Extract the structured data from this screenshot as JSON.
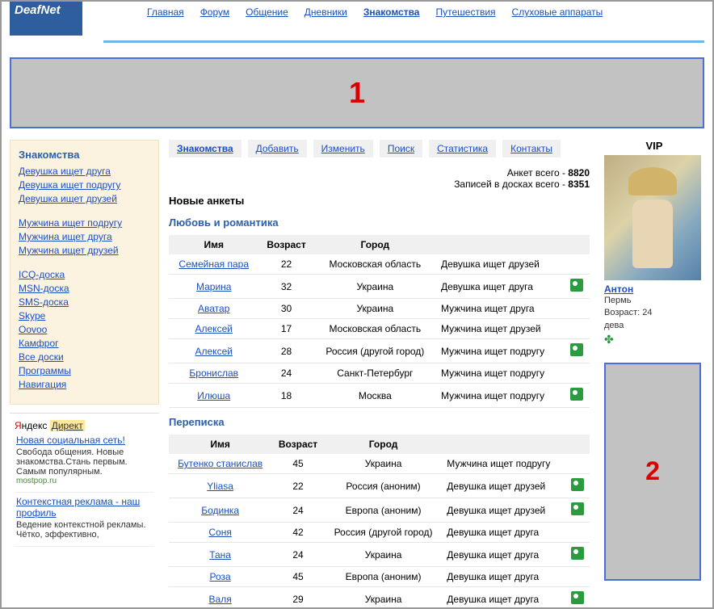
{
  "logo": "DeafNet",
  "nav": [
    "Главная",
    "Форум",
    "Общение",
    "Дневники",
    "Знакомства",
    "Путешествия",
    "Слуховые аппараты"
  ],
  "nav_active": 4,
  "banner1_num": "1",
  "banner2_num": "2",
  "left_title": "Знакомства",
  "left_group1": [
    "Девушка ищет друга",
    "Девушка ищет подругу",
    "Девушка ищет друзей"
  ],
  "left_group2": [
    "Мужчина ищет подругу",
    "Мужчина ищет друга",
    "Мужчина ищет друзей"
  ],
  "left_group3": [
    "ICQ-доска",
    "MSN-доска",
    "SMS-доска",
    "Skype",
    "Oovoo",
    "Камфрог",
    "Все доски",
    "Программы",
    "Навигация"
  ],
  "yandex": {
    "y": "Я",
    "ndex": "ндекс",
    "direct": "Директ"
  },
  "ads": [
    {
      "title": "Новая социальная сеть!",
      "desc": "Свобода общения. Новые знакомства.Стань первым. Самым популярным.",
      "src": "mostpop.ru"
    },
    {
      "title": "Контекстная реклама - наш профиль",
      "desc": "Ведение контекстной рекламы. Чётко, эффективно,",
      "src": ""
    }
  ],
  "subnav": [
    "Знакомства",
    "Добавить",
    "Изменить",
    "Поиск",
    "Статистика",
    "Контакты"
  ],
  "stats": {
    "l1a": "Анкет всего - ",
    "l1b": "8820",
    "l2a": "Записей в досках всего - ",
    "l2b": "8351"
  },
  "new_title": "Новые анкеты",
  "headers": {
    "name": "Имя",
    "age": "Возраст",
    "city": "Город"
  },
  "cat1": {
    "title": "Любовь и романтика",
    "rows": [
      {
        "name": "Семейная пара",
        "age": "22",
        "city": "Московская область",
        "type": "Девушка ищет друзей",
        "photo": false
      },
      {
        "name": "Марина",
        "age": "32",
        "city": "Украина",
        "type": "Девушка ищет друга",
        "photo": true
      },
      {
        "name": "Аватар",
        "age": "30",
        "city": "Украина",
        "type": "Мужчина ищет друга",
        "photo": false
      },
      {
        "name": "Алексей",
        "age": "17",
        "city": "Московская область",
        "type": "Мужчина ищет друзей",
        "photo": false
      },
      {
        "name": "Алексей",
        "age": "28",
        "city": "Россия (другой город)",
        "type": "Мужчина ищет подругу",
        "photo": true
      },
      {
        "name": "Бронислав",
        "age": "24",
        "city": "Санкт-Петербург",
        "type": "Мужчина ищет подругу",
        "photo": false
      },
      {
        "name": "Илюша",
        "age": "18",
        "city": "Москва",
        "type": "Мужчина ищет подругу",
        "photo": true
      }
    ]
  },
  "cat2": {
    "title": "Переписка",
    "rows": [
      {
        "name": "Бутенко станислав",
        "age": "45",
        "city": "Украина",
        "type": "Мужчина ищет подругу",
        "photo": false
      },
      {
        "name": "Yliasa",
        "age": "22",
        "city": "Россия (аноним)",
        "type": "Девушка ищет друзей",
        "photo": true
      },
      {
        "name": "Бодинка",
        "age": "24",
        "city": "Европа (аноним)",
        "type": "Девушка ищет друзей",
        "photo": true
      },
      {
        "name": "Соня",
        "age": "42",
        "city": "Россия (другой город)",
        "type": "Девушка ищет друга",
        "photo": false
      },
      {
        "name": "Тана",
        "age": "24",
        "city": "Украина",
        "type": "Девушка ищет друга",
        "photo": true
      },
      {
        "name": "Роза",
        "age": "45",
        "city": "Европа (аноним)",
        "type": "Девушка ищет друга",
        "photo": false
      },
      {
        "name": "Валя",
        "age": "29",
        "city": "Украина",
        "type": "Девушка ищет друга",
        "photo": true
      }
    ]
  },
  "vip": {
    "label": "VIP",
    "name": "Антон",
    "city": "Пермь",
    "age_label": "Возраст: 24",
    "sign": "дева"
  }
}
